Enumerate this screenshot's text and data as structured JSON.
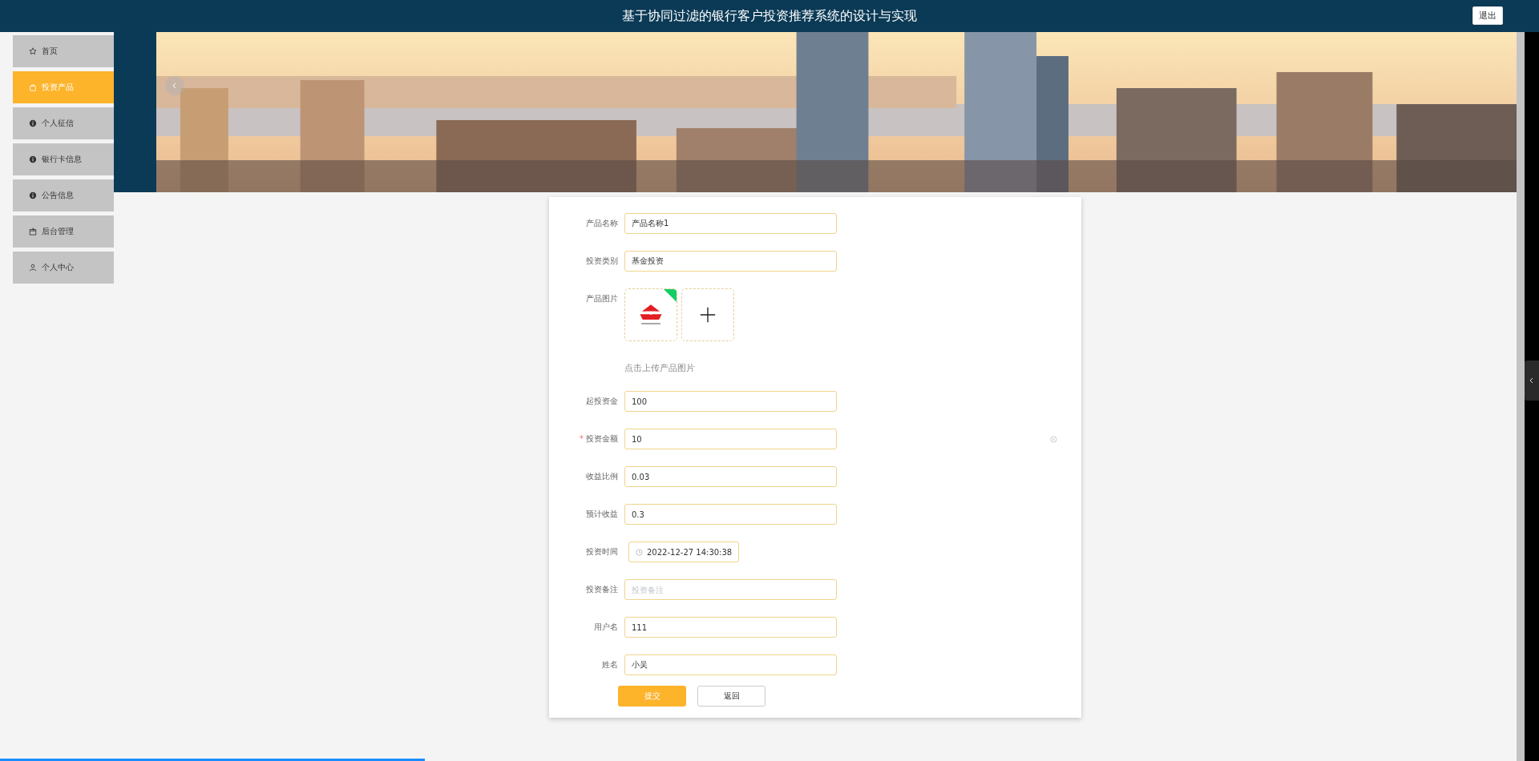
{
  "header": {
    "title": "基于协同过滤的银行客户投资推荐系统的设计与实现",
    "logout": "退出"
  },
  "sidebar": {
    "items": [
      {
        "label": "首页",
        "selected": false
      },
      {
        "label": "投资产品",
        "selected": true
      },
      {
        "label": "个人征信",
        "selected": false
      },
      {
        "label": "银行卡信息",
        "selected": false
      },
      {
        "label": "公告信息",
        "selected": false
      },
      {
        "label": "后台管理",
        "selected": false
      },
      {
        "label": "个人中心",
        "selected": false
      }
    ]
  },
  "form": {
    "fields": [
      {
        "kind": "text",
        "label": "产品名称",
        "value": "产品名称1"
      },
      {
        "kind": "text",
        "label": "投资类别",
        "value": "基金投资"
      },
      {
        "kind": "upload",
        "label": "产品图片",
        "hint": "点击上传产品图片"
      },
      {
        "kind": "text",
        "label": "起投资金",
        "value": "100"
      },
      {
        "kind": "text",
        "label": "投资金额",
        "value": "10",
        "required_mark": "*"
      },
      {
        "kind": "text",
        "label": "收益比例",
        "value": "0.03"
      },
      {
        "kind": "text",
        "label": "预计收益",
        "value": "0.3"
      },
      {
        "kind": "date",
        "label": "投资时间",
        "value": "2022-12-27 14:30:38"
      },
      {
        "kind": "text",
        "label": "投资备注",
        "placeholder": "投资备注"
      },
      {
        "kind": "text",
        "label": "用户名",
        "value": "111"
      },
      {
        "kind": "text",
        "label": "姓名",
        "value": "小吴"
      }
    ],
    "buttons": [
      {
        "kind": "primary",
        "label": "提交"
      },
      {
        "kind": "plain",
        "label": "返回"
      }
    ]
  },
  "playback": {
    "level": 0.28
  }
}
